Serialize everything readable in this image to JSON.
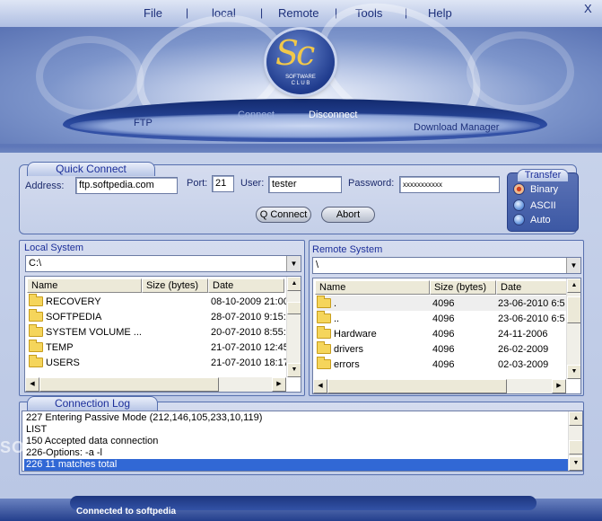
{
  "menu": {
    "items": [
      "File",
      "local",
      "Remote",
      "Tools",
      "Help"
    ],
    "close_glyph": "X"
  },
  "logo": {
    "initials": "Sc",
    "line1": "SOFTWARE",
    "line2": "C L U B"
  },
  "nav": {
    "ftp": "FTP",
    "connect": "Connect",
    "disconnect": "Disconnect",
    "download_manager": "Download Manager"
  },
  "quick_connect": {
    "title": "Quick Connect",
    "address_label": "Address:",
    "address_value": "ftp.softpedia.com",
    "port_label": "Port:",
    "port_value": "21",
    "user_label": "User:",
    "user_value": "tester",
    "password_label": "Password:",
    "password_value": "xxxxxxxxxxx",
    "connect_button": "Q Connect",
    "abort_button": "Abort"
  },
  "transfer": {
    "title": "Transfer",
    "options": [
      "Binary",
      "ASCII",
      "Auto"
    ],
    "selected": "Binary"
  },
  "local_system": {
    "title": "Local System",
    "path": "C:\\",
    "columns": [
      "Name",
      "Size (bytes)",
      "Date"
    ],
    "rows": [
      {
        "name": "RECOVERY",
        "size": "",
        "date": "08-10-2009 21:00"
      },
      {
        "name": "SOFTPEDIA",
        "size": "",
        "date": "28-07-2010 9:15:"
      },
      {
        "name": "SYSTEM VOLUME ...",
        "size": "",
        "date": "20-07-2010 8:55:"
      },
      {
        "name": "TEMP",
        "size": "",
        "date": "21-07-2010 12:45"
      },
      {
        "name": "USERS",
        "size": "",
        "date": "21-07-2010 18:17"
      }
    ]
  },
  "remote_system": {
    "title": "Remote System",
    "path": "\\",
    "columns": [
      "Name",
      "Size (bytes)",
      "Date"
    ],
    "rows": [
      {
        "name": ".",
        "size": "4096",
        "date": "23-06-2010 6:5"
      },
      {
        "name": "..",
        "size": "4096",
        "date": "23-06-2010 6:5"
      },
      {
        "name": "Hardware",
        "size": "4096",
        "date": "24-11-2006"
      },
      {
        "name": "drivers",
        "size": "4096",
        "date": "26-02-2009"
      },
      {
        "name": "errors",
        "size": "4096",
        "date": "02-03-2009"
      }
    ]
  },
  "connection_log": {
    "title": "Connection Log",
    "lines": [
      "227 Entering Passive Mode (212,146,105,233,10,119)",
      "LIST",
      "150 Accepted data connection",
      "226-Options: -a -l",
      "226 11 matches total"
    ],
    "selected_index": 4
  },
  "status": {
    "text": "Connected to softpedia"
  },
  "watermark": {
    "text": "SO"
  },
  "colors": {
    "accent": "#1c2f9a",
    "selection": "#3168d5",
    "folder": "#f5d55b"
  }
}
